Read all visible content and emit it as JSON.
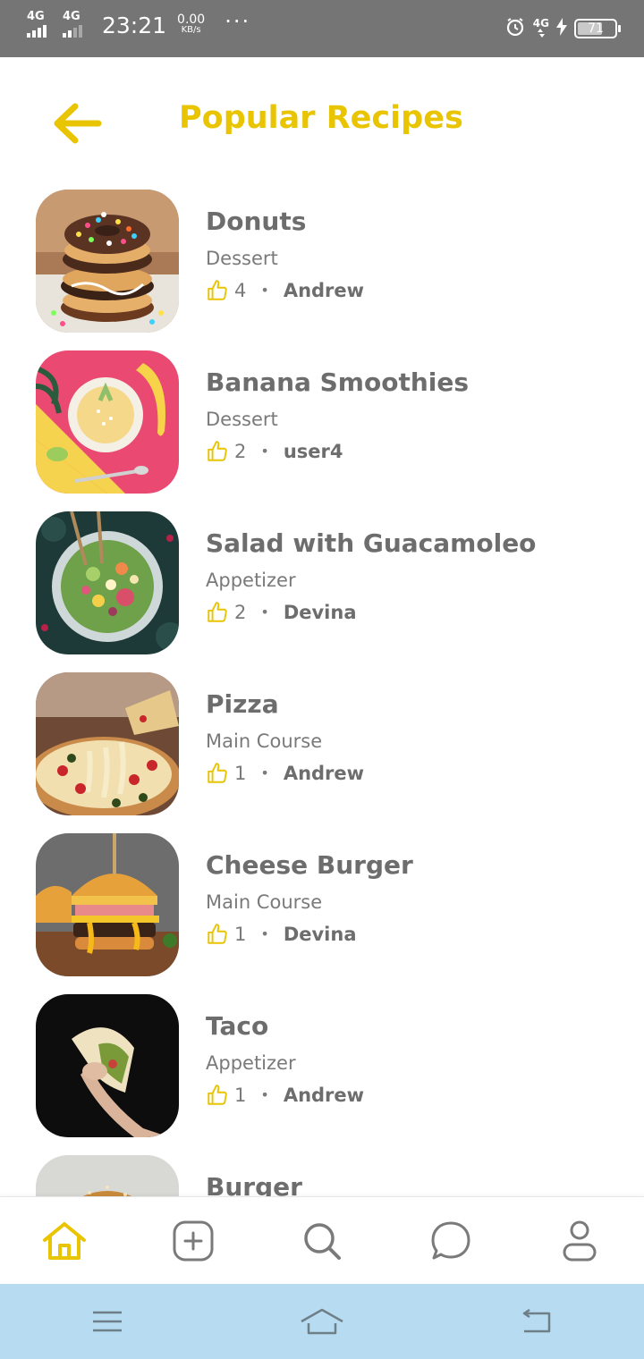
{
  "status_bar": {
    "network1": "4G",
    "network2": "4G",
    "time": "23:21",
    "speed_value": "0.00",
    "speed_unit": "KB/s",
    "more": "···",
    "right_network": "4G",
    "battery": "71",
    "battery_level": 0.71
  },
  "header": {
    "title": "Popular Recipes",
    "back_icon": "arrow-left-icon"
  },
  "colors": {
    "accent": "#e9c400",
    "text_dark": "#6d6d6d",
    "text_muted": "#7a7a7a",
    "system_nav_bg": "#b7dcf2",
    "status_bar_bg": "#757575"
  },
  "recipes": [
    {
      "name": "Donuts",
      "category": "Dessert",
      "likes": "4",
      "author": "Andrew"
    },
    {
      "name": "Banana Smoothies",
      "category": "Dessert",
      "likes": "2",
      "author": "user4"
    },
    {
      "name": "Salad with Guacamoleo",
      "category": "Appetizer",
      "likes": "2",
      "author": "Devina"
    },
    {
      "name": "Pizza",
      "category": "Main Course",
      "likes": "1",
      "author": "Andrew"
    },
    {
      "name": "Cheese Burger",
      "category": "Main Course",
      "likes": "1",
      "author": "Devina"
    },
    {
      "name": "Taco",
      "category": "Appetizer",
      "likes": "1",
      "author": "Andrew"
    },
    {
      "name": "Burger",
      "category": "",
      "likes": "",
      "author": ""
    }
  ],
  "like_icon": "thumbs-up-icon",
  "bottom_nav": [
    {
      "icon": "home-icon",
      "active": true
    },
    {
      "icon": "add-square-icon",
      "active": false
    },
    {
      "icon": "search-icon",
      "active": false
    },
    {
      "icon": "chat-bubble-icon",
      "active": false
    },
    {
      "icon": "user-icon",
      "active": false
    }
  ],
  "system_nav": [
    {
      "icon": "menu-icon"
    },
    {
      "icon": "home-outline-icon"
    },
    {
      "icon": "back-icon"
    }
  ]
}
